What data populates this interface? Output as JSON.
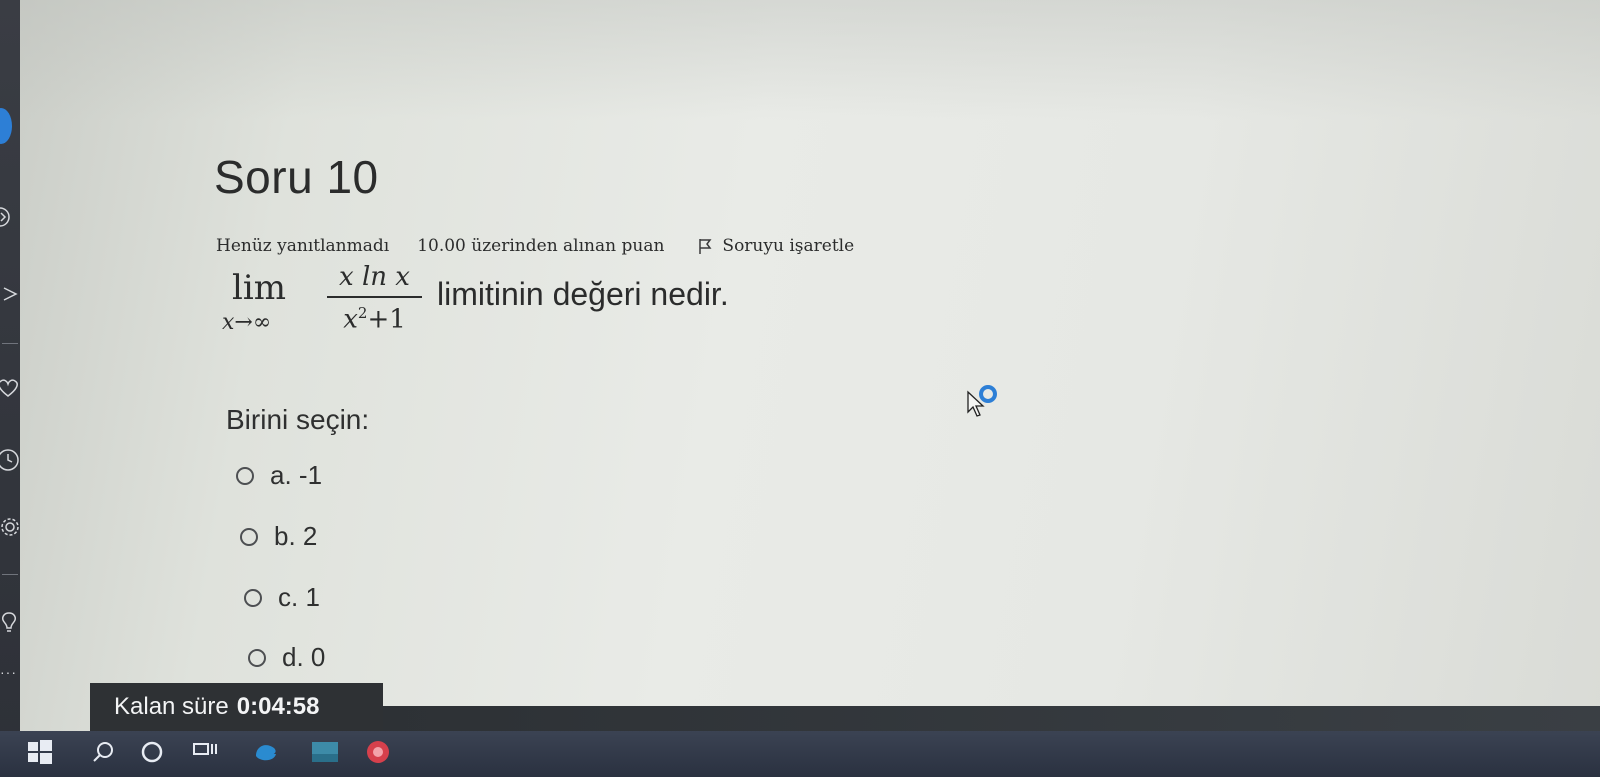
{
  "question": {
    "title": "Soru 10",
    "status": "Henüz yanıtlanmadı",
    "points": "10.00 üzerinden alınan puan",
    "flag_label": "Soruyu işaretle",
    "math": {
      "lim": "lim",
      "lim_sub": "x→∞",
      "numerator": "x ln x",
      "denominator_base": "x",
      "denominator_exp": "2",
      "denominator_rest": "+1"
    },
    "text": "limitinin değeri nedir.",
    "prompt": "Birini seçin:",
    "options": [
      {
        "label": "a. -1"
      },
      {
        "label": "b. 2"
      },
      {
        "label": "c. 1"
      },
      {
        "label": "d. 0"
      }
    ]
  },
  "timer": {
    "label": "Kalan süre",
    "value": "0:04:58"
  },
  "icons": {
    "sidebar": [
      "chevron-right-icon",
      "heart-icon",
      "clock-icon",
      "gear-icon",
      "lightbulb-icon",
      "more-icon"
    ],
    "taskbar": [
      "windows-start-icon",
      "search-icon",
      "cortana-icon",
      "task-view-icon",
      "edge-icon",
      "store-icon",
      "app-icon"
    ]
  },
  "colors": {
    "accent_blue": "#2d7fd6",
    "timer_bg": "#2e3134",
    "text": "#2b2c2c",
    "taskbar": "#2a3140"
  }
}
